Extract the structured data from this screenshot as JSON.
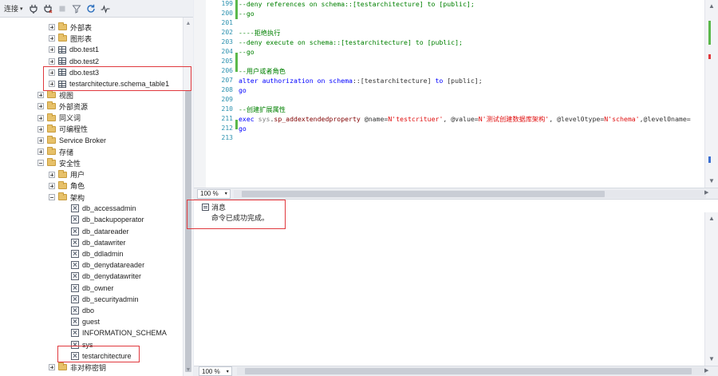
{
  "toolbar": {
    "connect_label": "连接",
    "connect_caret": "▾"
  },
  "tree": {
    "items": [
      {
        "label": "外部表",
        "depth": 3,
        "icon": "folder-icon",
        "expanded": false
      },
      {
        "label": "图形表",
        "depth": 3,
        "icon": "folder-icon",
        "expanded": false
      },
      {
        "label": "dbo.test1",
        "depth": 3,
        "icon": "table-icon",
        "expanded": false
      },
      {
        "label": "dbo.test2",
        "depth": 3,
        "icon": "table-icon",
        "expanded": false
      },
      {
        "label": "dbo.test3",
        "depth": 3,
        "icon": "table-icon",
        "expanded": false
      },
      {
        "label": "testarchitecture.schema_table1",
        "depth": 3,
        "icon": "table-icon",
        "expanded": false
      },
      {
        "label": "视图",
        "depth": 2,
        "icon": "folder-icon",
        "expanded": false
      },
      {
        "label": "外部资源",
        "depth": 2,
        "icon": "folder-icon",
        "expanded": false
      },
      {
        "label": "同义词",
        "depth": 2,
        "icon": "folder-icon",
        "expanded": false
      },
      {
        "label": "可编程性",
        "depth": 2,
        "icon": "folder-icon",
        "expanded": false
      },
      {
        "label": "Service Broker",
        "depth": 2,
        "icon": "folder-icon",
        "expanded": false
      },
      {
        "label": "存储",
        "depth": 2,
        "icon": "folder-icon",
        "expanded": false
      },
      {
        "label": "安全性",
        "depth": 2,
        "icon": "folder-icon",
        "expanded": true
      },
      {
        "label": "用户",
        "depth": 3,
        "icon": "folder-icon",
        "expanded": false
      },
      {
        "label": "角色",
        "depth": 3,
        "icon": "folder-icon",
        "expanded": false
      },
      {
        "label": "架构",
        "depth": 3,
        "icon": "folder-icon",
        "expanded": true
      },
      {
        "label": "db_accessadmin",
        "depth": 4,
        "icon": "schema-icon"
      },
      {
        "label": "db_backupoperator",
        "depth": 4,
        "icon": "schema-icon"
      },
      {
        "label": "db_datareader",
        "depth": 4,
        "icon": "schema-icon"
      },
      {
        "label": "db_datawriter",
        "depth": 4,
        "icon": "schema-icon"
      },
      {
        "label": "db_ddladmin",
        "depth": 4,
        "icon": "schema-icon"
      },
      {
        "label": "db_denydatareader",
        "depth": 4,
        "icon": "schema-icon"
      },
      {
        "label": "db_denydatawriter",
        "depth": 4,
        "icon": "schema-icon"
      },
      {
        "label": "db_owner",
        "depth": 4,
        "icon": "schema-icon"
      },
      {
        "label": "db_securityadmin",
        "depth": 4,
        "icon": "schema-icon"
      },
      {
        "label": "dbo",
        "depth": 4,
        "icon": "schema-icon"
      },
      {
        "label": "guest",
        "depth": 4,
        "icon": "schema-icon"
      },
      {
        "label": "INFORMATION_SCHEMA",
        "depth": 4,
        "icon": "schema-icon"
      },
      {
        "label": "sys",
        "depth": 4,
        "icon": "schema-icon"
      },
      {
        "label": "testarchitecture",
        "depth": 4,
        "icon": "schema-icon"
      },
      {
        "label": "非对称密钥",
        "depth": 3,
        "icon": "folder-icon",
        "expanded": false
      }
    ]
  },
  "editor": {
    "lines": [
      {
        "no": "199",
        "tokens": [
          {
            "c": "cmt",
            "t": "--deny references on schema::[testarchitecture] to [public];"
          }
        ]
      },
      {
        "no": "200",
        "tokens": [
          {
            "c": "cmt",
            "t": "--go"
          }
        ]
      },
      {
        "no": "201",
        "tokens": []
      },
      {
        "no": "202",
        "tokens": [
          {
            "c": "cmt",
            "t": "----拒绝执行"
          }
        ]
      },
      {
        "no": "203",
        "tokens": [
          {
            "c": "cmt",
            "t": "--deny execute on schema::[testarchitecture] to [public];"
          }
        ]
      },
      {
        "no": "204",
        "tokens": [
          {
            "c": "cmt",
            "t": "--go"
          }
        ]
      },
      {
        "no": "205",
        "tokens": []
      },
      {
        "no": "206",
        "tokens": [
          {
            "c": "cmt",
            "t": "--用户或者角色"
          }
        ]
      },
      {
        "no": "207",
        "tokens": [
          {
            "c": "kw",
            "t": "alter authorization on schema"
          },
          {
            "c": "txt",
            "t": "::[testarchitecture] "
          },
          {
            "c": "kw",
            "t": "to"
          },
          {
            "c": "txt",
            "t": " [public];"
          }
        ]
      },
      {
        "no": "208",
        "tokens": [
          {
            "c": "kw",
            "t": "go"
          }
        ]
      },
      {
        "no": "209",
        "tokens": []
      },
      {
        "no": "210",
        "tokens": [
          {
            "c": "cmt",
            "t": "--创建扩展属性"
          }
        ]
      },
      {
        "no": "211",
        "tokens": [
          {
            "c": "kw",
            "t": "exec "
          },
          {
            "c": "fn",
            "t": "sys"
          },
          {
            "c": "txt",
            "t": "."
          },
          {
            "c": "prop",
            "t": "sp_addextendedproperty"
          },
          {
            "c": "txt",
            "t": " @name="
          },
          {
            "c": "str",
            "t": "N'testcrituer'"
          },
          {
            "c": "txt",
            "t": ", @value="
          },
          {
            "c": "str",
            "t": "N'测试创建数据库架构'"
          },
          {
            "c": "txt",
            "t": ", @level0type="
          },
          {
            "c": "str",
            "t": "N'schema'"
          },
          {
            "c": "txt",
            "t": ",@level0name="
          }
        ]
      },
      {
        "no": "212",
        "tokens": [
          {
            "c": "kw",
            "t": "go"
          }
        ]
      },
      {
        "no": "213",
        "tokens": []
      }
    ]
  },
  "zoom": {
    "editor": "100 %",
    "results": "100 %",
    "caret": "▾"
  },
  "results": {
    "tab_label": "消息",
    "message": "命令已成功完成。"
  }
}
